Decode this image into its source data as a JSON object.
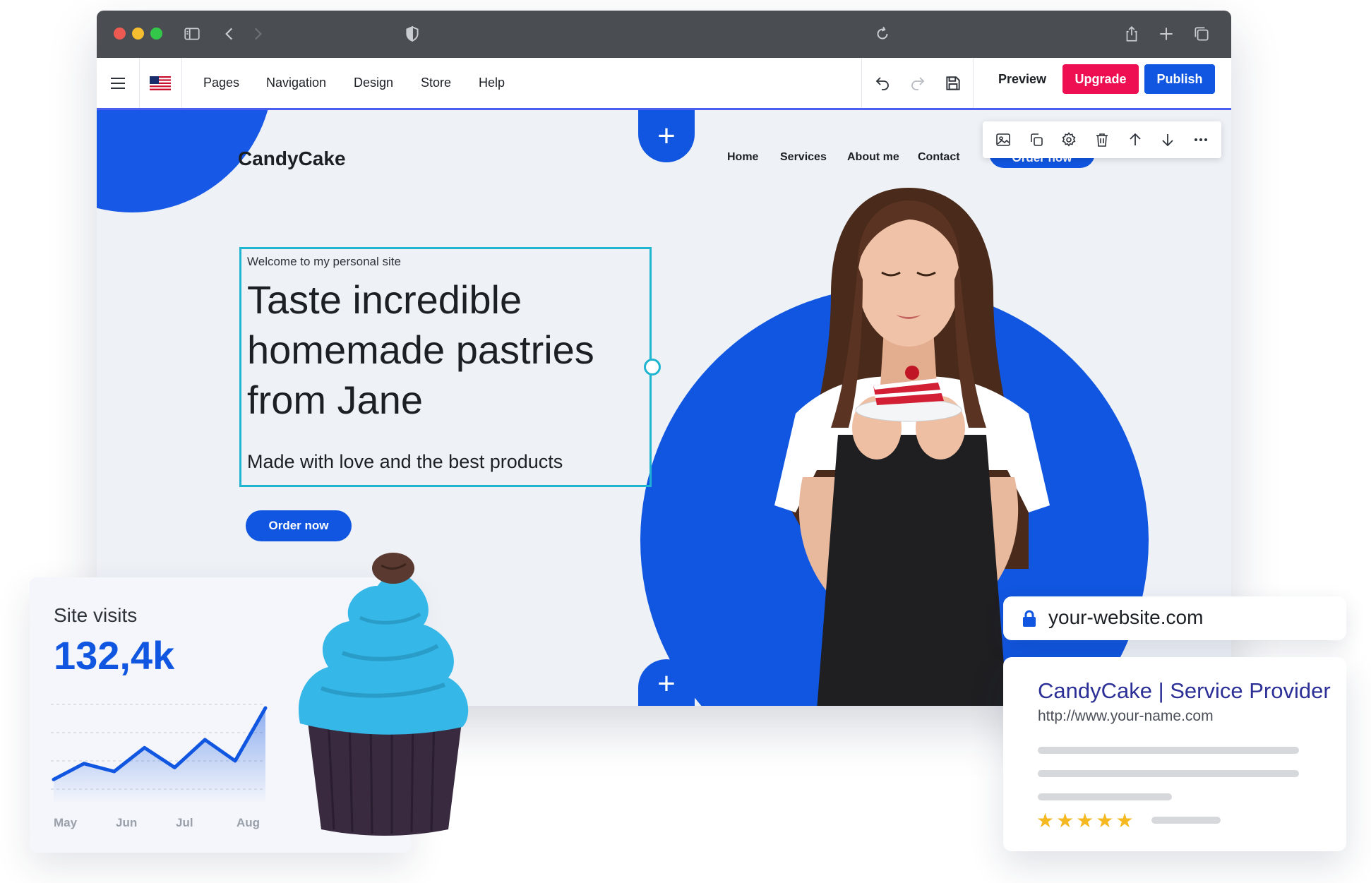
{
  "editor": {
    "menu": [
      "Pages",
      "Navigation",
      "Design",
      "Store",
      "Help"
    ],
    "preview_label": "Preview",
    "upgrade_label": "Upgrade",
    "publish_label": "Publish",
    "colors": {
      "upgrade": "#ee0f53",
      "publish": "#1156e0",
      "accent": "#4a5ff0"
    }
  },
  "site": {
    "brand": "CandyCake",
    "nav": [
      "Home",
      "Services",
      "About me",
      "Contact"
    ],
    "nav_cta": "Order now",
    "eyebrow": "Welcome to my personal site",
    "headline": "Taste incredible homemade pastries from Jane",
    "subheadline": "Made with love and the best products",
    "cta": "Order now",
    "colors": {
      "primary": "#1156e0",
      "selection": "#1fb4cf"
    }
  },
  "visits": {
    "title": "Site visits",
    "value": "132,4k",
    "months": [
      "May",
      "Jun",
      "Jul",
      "Aug"
    ]
  },
  "chart_data": {
    "type": "area",
    "categories": [
      "May",
      "Jun",
      "Jul",
      "Aug"
    ],
    "values": [
      18,
      30,
      24,
      42,
      27,
      48,
      32,
      72
    ],
    "ylim": [
      0,
      80
    ],
    "grid": true
  },
  "url_bar": {
    "url": "your-website.com"
  },
  "serp": {
    "title": "CandyCake | Service Provider",
    "url": "http://www.your-name.com",
    "rating": 5
  }
}
